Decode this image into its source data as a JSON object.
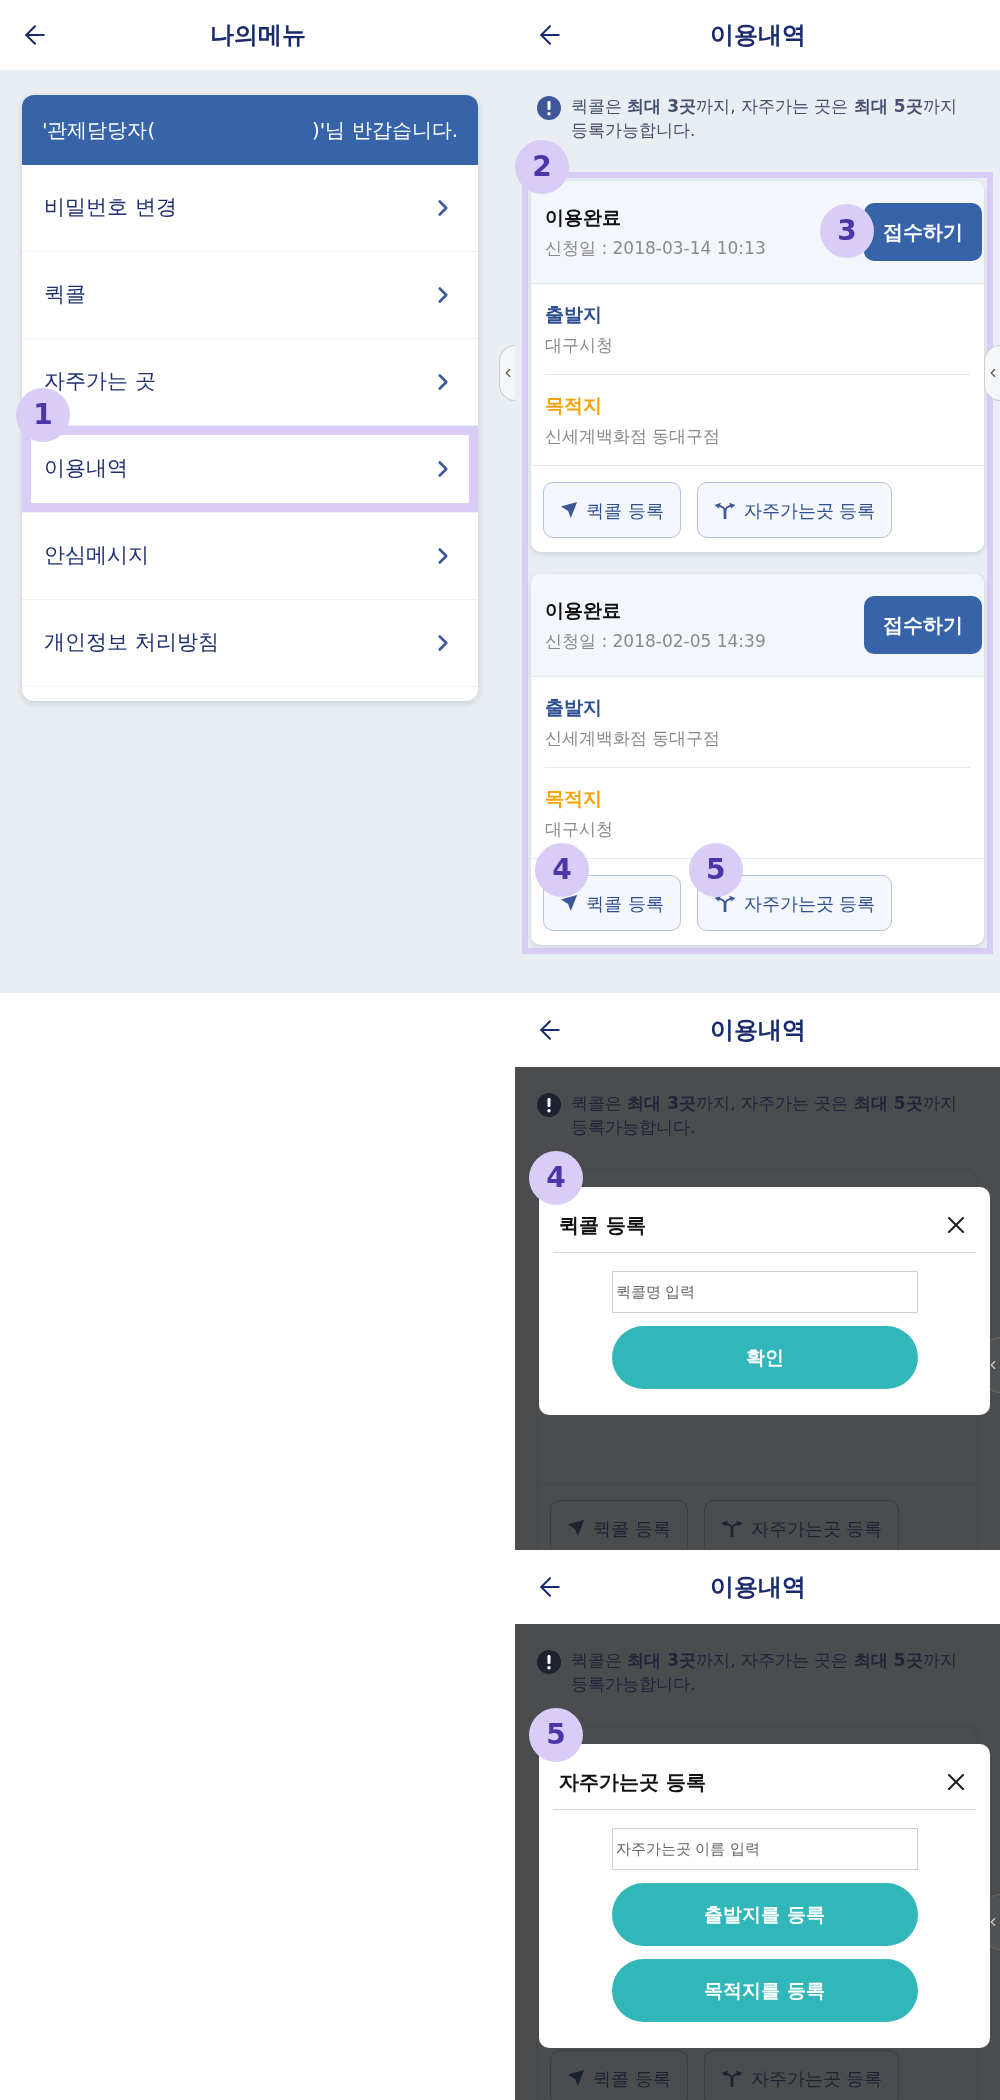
{
  "screens": [
    {
      "kind": "menu",
      "title": "나의메뉴",
      "greeting": [
        "'관제담당자(",
        ")'님 반갑습니다."
      ],
      "items": [
        {
          "label": "비밀번호 변경",
          "highlighted": false
        },
        {
          "label": "퀵콜",
          "highlighted": false
        },
        {
          "label": "자주가는 곳",
          "highlighted": false
        },
        {
          "label": "이용내역",
          "highlighted": true,
          "badge": "1"
        },
        {
          "label": "안심메시지",
          "highlighted": false
        },
        {
          "label": "개인정보 처리방침",
          "highlighted": false
        }
      ]
    },
    {
      "kind": "history",
      "title": "이용내역",
      "notice": "퀵콜은 **최대 3곳**까지, 자주가는 곳은 **최대 5곳**까지 등록가능합니다.",
      "list_badge": "2",
      "list_highlighted": true,
      "records": [
        {
          "status": "이용완료",
          "date": "신청일 : 2018-03-14 10:13",
          "action": "접수하기",
          "action_badge": "3",
          "origin_label": "출발지",
          "origin": "대구시청",
          "destination_label": "목적지",
          "destination": "신세계백화점 동대구점",
          "buttons": [
            {
              "kind": "quick",
              "label": "퀵콜 등록"
            },
            {
              "kind": "favorite",
              "label": "자주가는곳 등록"
            }
          ]
        },
        {
          "status": "이용완료",
          "date": "신청일 : 2018-02-05 14:39",
          "action": "접수하기",
          "origin_label": "출발지",
          "origin": "신세계백화점 동대구점",
          "destination_label": "목적지",
          "destination": "대구시청",
          "buttons": [
            {
              "kind": "quick",
              "label": "퀵콜 등록",
              "badge": "4"
            },
            {
              "kind": "favorite",
              "label": "자주가는곳 등록",
              "badge": "5"
            }
          ]
        }
      ]
    },
    {
      "kind": "dialog",
      "title": "이용내역",
      "notice": "퀵콜은 **최대 3곳**까지, 자주가는 곳은 **최대 5곳**까지 등록가능합니다.",
      "background_buttons": [
        {
          "kind": "quick",
          "label": "퀵콜 등록"
        },
        {
          "kind": "favorite",
          "label": "자주가는곳 등록"
        }
      ],
      "dialog": {
        "badge": "4",
        "title": "퀵콜 등록",
        "input": {
          "placeholder": "퀵콜명 입력"
        },
        "actions": [
          "확인"
        ]
      }
    },
    {
      "kind": "dialog",
      "title": "이용내역",
      "notice": "퀵콜은 **최대 3곳**까지, 자주가는 곳은 **최대 5곳**까지 등록가능합니다.",
      "background_buttons": [
        {
          "kind": "quick",
          "label": "퀵콜 등록"
        },
        {
          "kind": "favorite",
          "label": "자주가는곳 등록"
        }
      ],
      "dialog": {
        "badge": "5",
        "title": "자주가는곳 등록",
        "input": {
          "placeholder": "자주가는곳 이름 입력"
        },
        "actions": [
          "출발지를 등록",
          "목적지를 등록"
        ]
      }
    }
  ]
}
